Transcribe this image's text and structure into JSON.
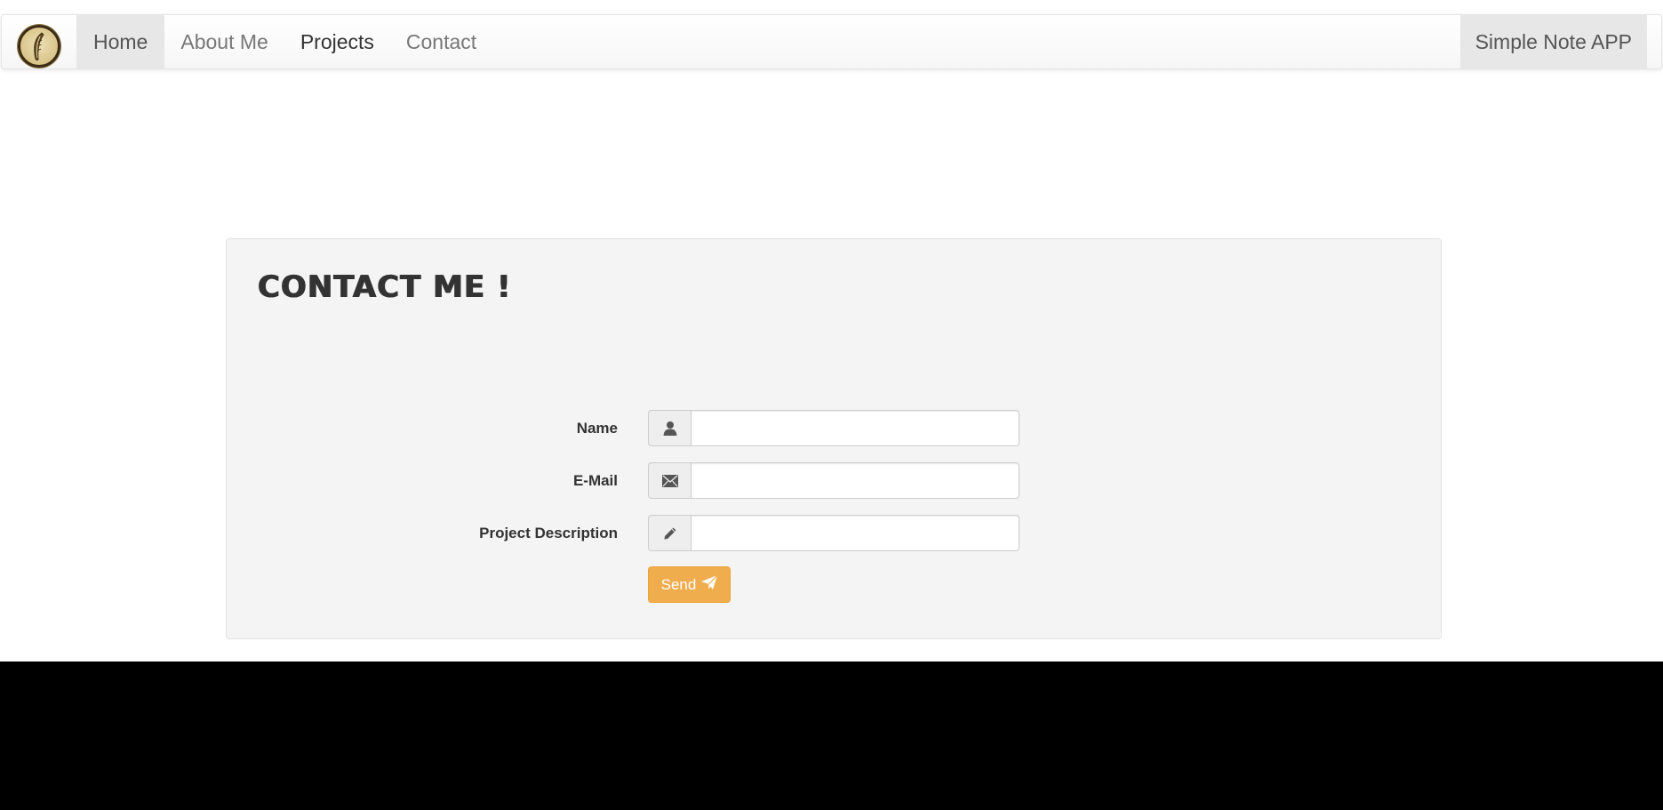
{
  "nav": {
    "logo_icon": "feather-logo-icon",
    "items": [
      {
        "label": "Home"
      },
      {
        "label": "About Me"
      },
      {
        "label": "Projects"
      },
      {
        "label": "Contact"
      }
    ],
    "right_label": "Simple Note APP"
  },
  "contact": {
    "title": "CONTACT ME !",
    "fields": {
      "name": {
        "label": "Name",
        "icon": "user-icon",
        "value": "",
        "placeholder": ""
      },
      "email": {
        "label": "E-Mail",
        "icon": "envelope-icon",
        "value": "",
        "placeholder": ""
      },
      "description": {
        "label": "Project Description",
        "icon": "pencil-icon",
        "value": "",
        "placeholder": ""
      }
    },
    "send_label": "Send",
    "send_icon": "paper-plane-icon"
  },
  "colors": {
    "accent": "#f0ad4e",
    "panel_bg": "#f4f4f4",
    "footer_bg": "#000000",
    "nav_active_bg": "#e7e7e7"
  }
}
